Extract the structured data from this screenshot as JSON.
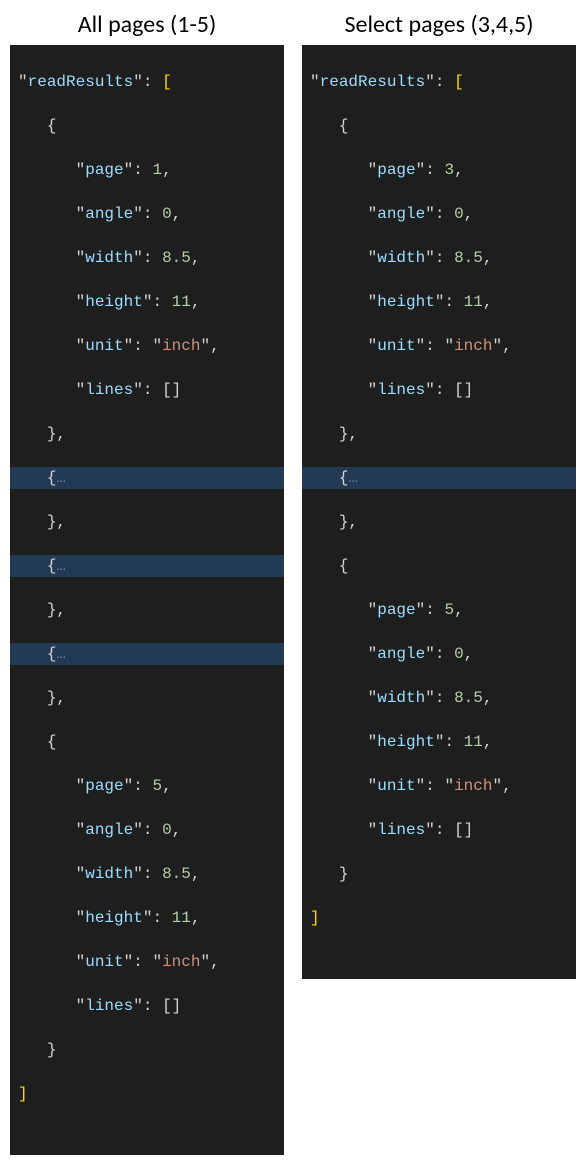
{
  "left": {
    "title": "All pages (1-5)",
    "arrayName": "readResults",
    "firstPage": {
      "page": 1,
      "angle": 0,
      "width": 8.5,
      "height": 11,
      "unit": "inch",
      "lines": "[]"
    },
    "fold1": "…",
    "fold2": "…",
    "fold3": "…",
    "lastPage": {
      "page": 5,
      "angle": 0,
      "width": 8.5,
      "height": 11,
      "unit": "inch",
      "lines": "[]"
    }
  },
  "right": {
    "title": "Select pages (3,4,5)",
    "arrayName": "readResults",
    "firstPage": {
      "page": 3,
      "angle": 0,
      "width": 8.5,
      "height": 11,
      "unit": "inch",
      "lines": "[]"
    },
    "fold1": "…",
    "lastPage": {
      "page": 5,
      "angle": 0,
      "width": 8.5,
      "height": 11,
      "unit": "inch",
      "lines": "[]"
    }
  },
  "tokens": {
    "openBracket": "[",
    "closeBracket": "]",
    "openBrace": "{",
    "closeBrace": "}",
    "comma": ",",
    "colon": ":",
    "quote": "\""
  },
  "keys": {
    "page": "page",
    "angle": "angle",
    "width": "width",
    "height": "height",
    "unit": "unit",
    "lines": "lines"
  }
}
